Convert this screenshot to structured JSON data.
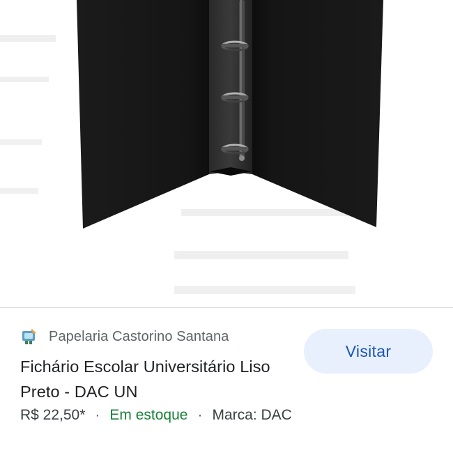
{
  "product_image": {
    "alt": "Fichário Escolar Universitário Liso Preto - DAC UN"
  },
  "merchant": {
    "name": "Papelaria Castorino Santana",
    "favicon_icon": "shop-favicon-icon"
  },
  "product": {
    "title": "Fichário Escolar Universitário Liso Preto - DAC UN",
    "price": "R$ 22,50*",
    "separator": "·",
    "availability": "Em estoque",
    "brand": "Marca: DAC"
  },
  "actions": {
    "visit_label": "Visitar"
  },
  "colors": {
    "accent": "#1a56b8",
    "button_bg": "#e8f0fe",
    "in_stock": "#188038",
    "binder": "#141414"
  }
}
